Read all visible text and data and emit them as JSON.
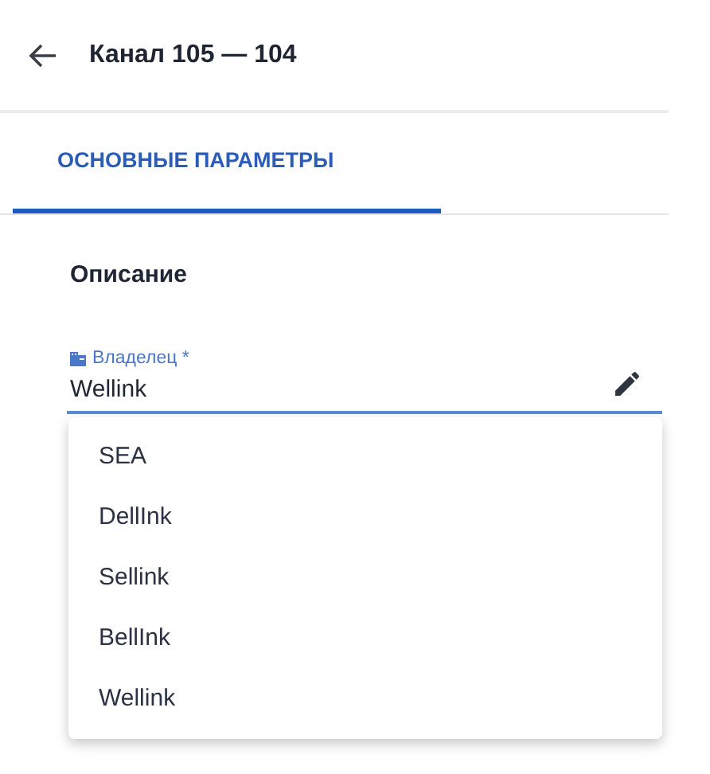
{
  "header": {
    "title": "Канал 105 — 104"
  },
  "tabs": [
    {
      "label": "ОСНОВНЫЕ ПАРАМЕТРЫ",
      "selected": true
    }
  ],
  "section": {
    "title": "Описание"
  },
  "field": {
    "label": "Владелец *",
    "value": "Wellink"
  },
  "dropdown": {
    "options": [
      {
        "label": "SEA"
      },
      {
        "label": "DellInk"
      },
      {
        "label": "Sellink"
      },
      {
        "label": "BellInk"
      },
      {
        "label": "Wellink"
      }
    ]
  }
}
